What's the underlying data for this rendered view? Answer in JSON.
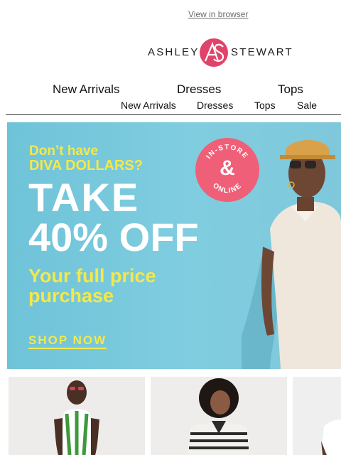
{
  "header": {
    "view_in_browser": "View in browser",
    "logo": {
      "left_word": "ASHLEY",
      "right_word": "STEWART",
      "monogram": "AS",
      "brand_color": "#e0446a"
    }
  },
  "nav_primary": [
    {
      "label": "New Arrivals"
    },
    {
      "label": "Dresses"
    },
    {
      "label": "Tops"
    }
  ],
  "nav_secondary": [
    {
      "label": "New Arrivals"
    },
    {
      "label": "Dresses"
    },
    {
      "label": "Tops"
    },
    {
      "label": "Sale"
    }
  ],
  "hero": {
    "eyebrow_line1": "Don’t have",
    "eyebrow_line2": "DIVA DOLLARS?",
    "headline_line1": "TAKE",
    "headline_line2": "40% OFF",
    "subhead_line1": "Your full price",
    "subhead_line2": "purchase",
    "cta": "SHOP NOW",
    "badge": {
      "top": "IN-STORE",
      "middle": "&",
      "bottom": "ONLINE",
      "color": "#ef5f78"
    },
    "colors": {
      "background": "#7ecbdd",
      "accent": "#f4e84a",
      "headline": "#ffffff"
    }
  },
  "product_tiles": [
    {
      "image": "model-green-striped-dress"
    },
    {
      "image": "model-black-white-striped-top"
    },
    {
      "image": "model-white-top"
    }
  ]
}
